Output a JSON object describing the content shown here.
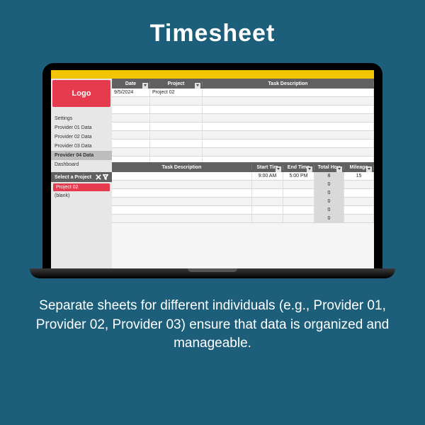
{
  "page_title": "Timesheet",
  "caption": "Separate sheets for different individuals (e.g., Provider 01, Provider 02, Provider 03) ensure that data is organized and manageable.",
  "logo": "Logo",
  "nav": [
    "Settings",
    "Provider 01 Data",
    "Provider 02 Data",
    "Provider 03 Data",
    "Provider 04 Data",
    "Dashboard"
  ],
  "nav_selected": "Provider 04 Data",
  "project_filter": {
    "label": "Select a Project",
    "selected": "Project 02",
    "blank": "(blank)"
  },
  "tbl1": {
    "headers": [
      "Date",
      "Project",
      "Task Description"
    ],
    "row": {
      "date": "9/5/2024",
      "project": "Project 02",
      "desc": ""
    }
  },
  "tbl2": {
    "headers": [
      "Task Description",
      "Start Tim",
      "End Time",
      "Total Hou",
      "Mileage"
    ],
    "rows": [
      {
        "desc": "",
        "start": "9:00 AM",
        "end": "5:00 PM",
        "hours": "8",
        "miles": "15"
      },
      {
        "desc": "",
        "start": "",
        "end": "",
        "hours": "0",
        "miles": ""
      },
      {
        "desc": "",
        "start": "",
        "end": "",
        "hours": "0",
        "miles": ""
      },
      {
        "desc": "",
        "start": "",
        "end": "",
        "hours": "0",
        "miles": ""
      },
      {
        "desc": "",
        "start": "",
        "end": "",
        "hours": "0",
        "miles": ""
      },
      {
        "desc": "",
        "start": "",
        "end": "",
        "hours": "0",
        "miles": ""
      }
    ]
  }
}
